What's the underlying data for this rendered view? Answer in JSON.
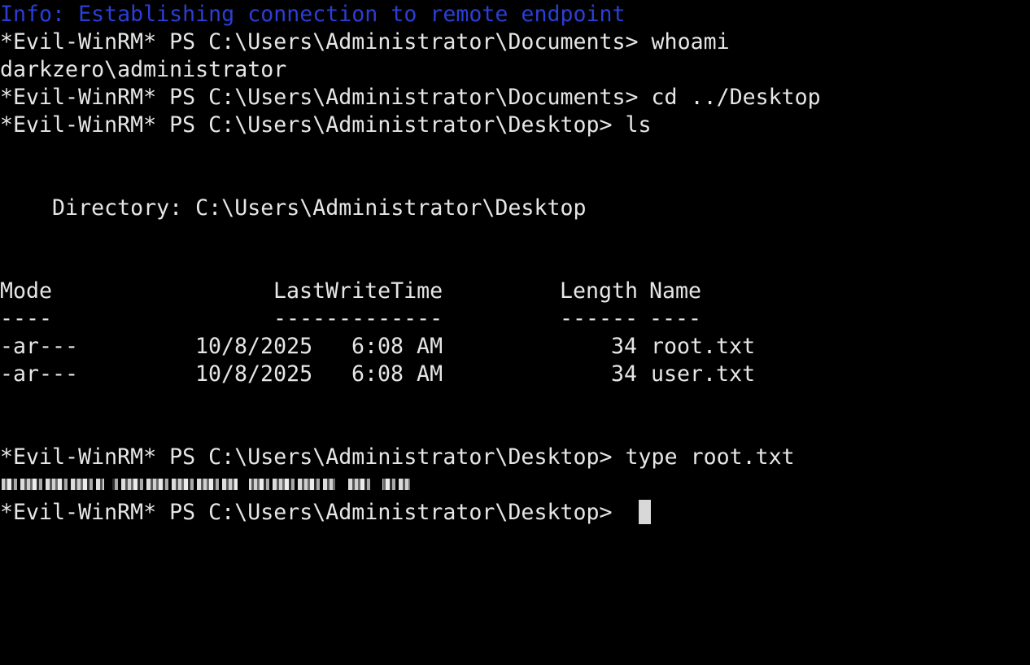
{
  "terminal": {
    "info_line": "Info: Establishing connection to remote endpoint",
    "prompt_documents": "*Evil-WinRM* PS C:\\Users\\Administrator\\Documents> ",
    "prompt_desktop": "*Evil-WinRM* PS C:\\Users\\Administrator\\Desktop> ",
    "cmd_whoami": "whoami",
    "output_whoami": "darkzero\\administrator",
    "cmd_cd": "cd ../Desktop",
    "cmd_ls": "ls",
    "directory_line": "    Directory: C:\\Users\\Administrator\\Desktop",
    "headers": {
      "mode": "Mode",
      "last_write_time": "LastWriteTime",
      "length": "Length",
      "name": "Name"
    },
    "separators": {
      "mode": "----",
      "last_write_time": "-------------",
      "length": "------",
      "name": "----"
    },
    "files": [
      {
        "mode": "-ar---",
        "date": "10/8/2025",
        "time": "6:08 AM",
        "length": "34",
        "name": "root.txt"
      },
      {
        "mode": "-ar---",
        "date": "10/8/2025",
        "time": "6:08 AM",
        "length": "34",
        "name": "user.txt"
      }
    ],
    "cmd_type": "type root.txt"
  },
  "colors": {
    "background": "#000000",
    "foreground": "#e6e6e6",
    "info": "#2a3fd6",
    "cursor": "#d8d8d8"
  }
}
